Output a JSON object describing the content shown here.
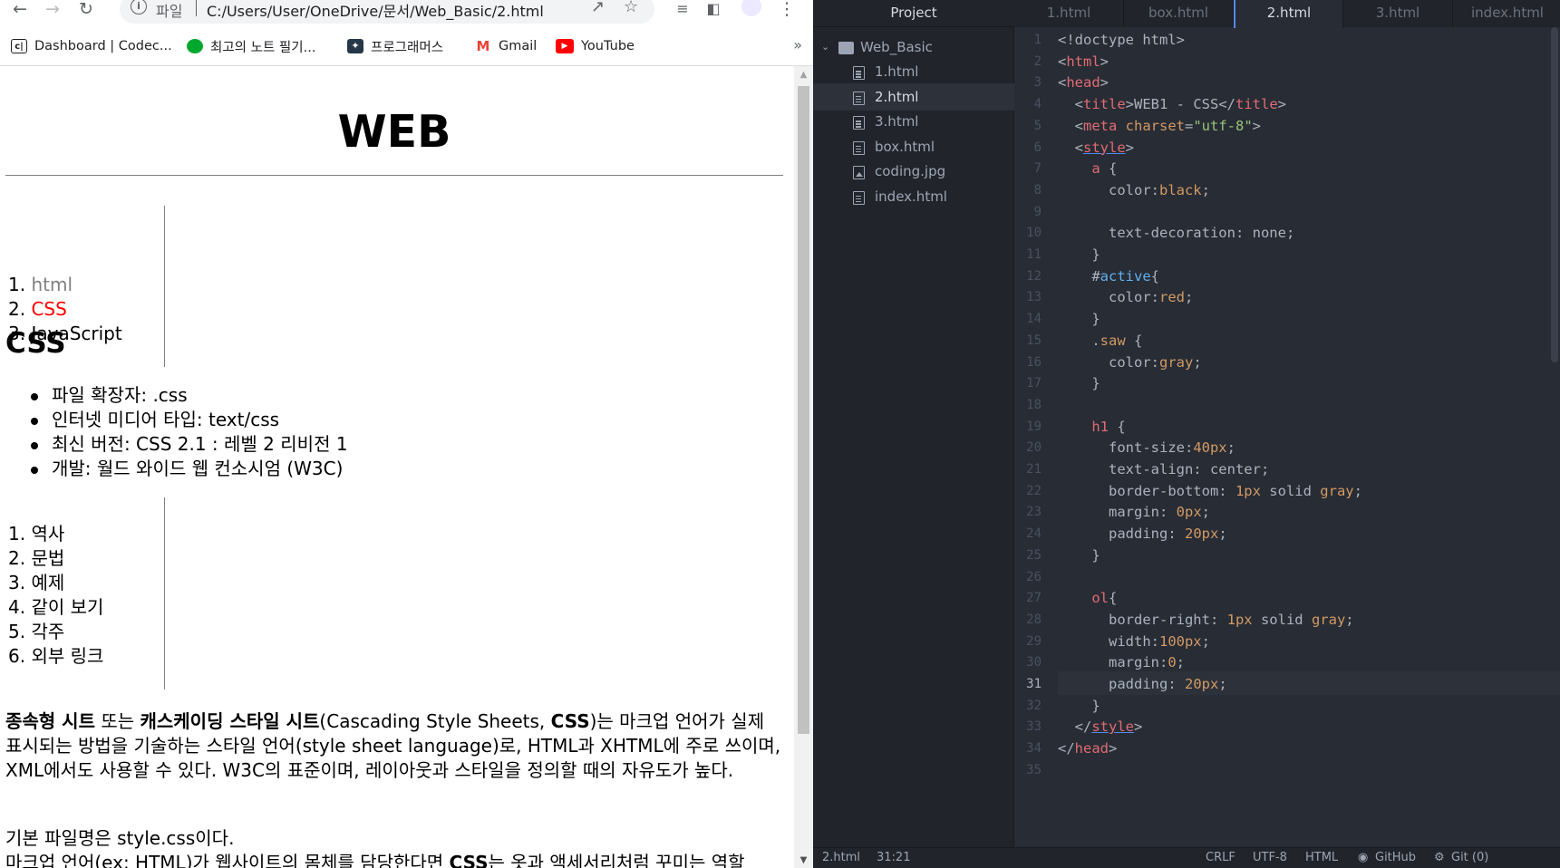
{
  "browser": {
    "url_scheme": "파일",
    "url": "C:/Users/User/OneDrive/문서/Web_Basic/2.html",
    "bookmarks": [
      {
        "label": "Dashboard | Codec...",
        "icon": "codecademy-icon",
        "color": "#1f1f1f"
      },
      {
        "label": "최고의 노트 필기...",
        "icon": "evernote-icon",
        "color": "#00a82d"
      },
      {
        "label": "프로그래머스",
        "icon": "programmers-icon",
        "color": "#263747"
      },
      {
        "label": "Gmail",
        "icon": "gmail-icon",
        "color": "#ea4335"
      },
      {
        "label": "YouTube",
        "icon": "youtube-icon",
        "color": "#ff0000"
      }
    ],
    "bookmarks_more": "»"
  },
  "page": {
    "h1": "WEB",
    "toc": [
      {
        "num": "1.",
        "label": "html",
        "style": "saw"
      },
      {
        "num": "2.",
        "label": "CSS",
        "style": "active"
      },
      {
        "num": "3.",
        "label": "JavaScript",
        "style": "normal"
      }
    ],
    "h2": "CSS",
    "facts": [
      "파일 확장자: .css",
      "인터넷 미디어 타입: text/css",
      "최신 버전: CSS 2.1 : 레벨 2 리비전 1",
      "개발: 월드 와이드 웹 컨소시엄 (W3C)"
    ],
    "sections": [
      "1. 역사",
      "2. 문법",
      "3. 예제",
      "4. 같이 보기",
      "5. 각주",
      "6. 외부 링크"
    ],
    "para1_b1": "종속형 시트",
    "para1_t1": " 또는 ",
    "para1_b2": "캐스케이딩 스타일 시트",
    "para1_t2": "(Cascading Style Sheets, ",
    "para1_b3": "CSS",
    "para1_t3": ")는 마크업 언어가 실제 표시되는 방법을 기술하는 스타일 언어(style sheet language)로, HTML과 XHTML에 주로 쓰이며, XML에서도 사용할 수 있다. W3C의 표준이며, 레이아웃과 스타일을 정의할 때의 자유도가 높다.",
    "para2_l1": "기본 파일명은 style.css이다.",
    "para2_t1": "마크업 언어(ex: HTML)가 웹사이트의 몸체를 담당한다면 ",
    "para2_b1": "CSS",
    "para2_t2": "는 옷과 액세서리처럼 꾸미는 역할"
  },
  "editor": {
    "project_title": "Project",
    "folder": "Web_Basic",
    "files": [
      {
        "name": "1.html",
        "icon": "file-icon"
      },
      {
        "name": "2.html",
        "icon": "file-icon",
        "selected": true
      },
      {
        "name": "3.html",
        "icon": "file-icon"
      },
      {
        "name": "box.html",
        "icon": "file-icon"
      },
      {
        "name": "coding.jpg",
        "icon": "image-icon"
      },
      {
        "name": "index.html",
        "icon": "file-icon"
      }
    ],
    "tabs": [
      "1.html",
      "box.html",
      "2.html",
      "3.html",
      "index.html"
    ],
    "active_tab": "2.html",
    "current_line": 31,
    "lines": [
      [
        [
          "c-plain",
          "<!doctype html>"
        ]
      ],
      [
        [
          "c-plain",
          "<"
        ],
        [
          "c-tag",
          "html"
        ],
        [
          "c-plain",
          ">"
        ]
      ],
      [
        [
          "c-plain",
          "<"
        ],
        [
          "c-tag",
          "head"
        ],
        [
          "c-plain",
          ">"
        ]
      ],
      [
        [
          "c-plain",
          "  <"
        ],
        [
          "c-tag",
          "title"
        ],
        [
          "c-plain",
          ">WEB1 - CSS</"
        ],
        [
          "c-tag",
          "title"
        ],
        [
          "c-plain",
          ">"
        ]
      ],
      [
        [
          "c-plain",
          "  <"
        ],
        [
          "c-tag",
          "meta"
        ],
        [
          "c-plain",
          " "
        ],
        [
          "c-attr",
          "charset"
        ],
        [
          "c-plain",
          "="
        ],
        [
          "c-str",
          "\"utf-8\""
        ],
        [
          "c-plain",
          ">"
        ]
      ],
      [
        [
          "c-plain",
          "  <"
        ],
        [
          "c-tag c-ul",
          "style"
        ],
        [
          "c-plain",
          ">"
        ]
      ],
      [
        [
          "c-plain",
          "    "
        ],
        [
          "c-sel",
          "a"
        ],
        [
          "c-plain",
          " {"
        ]
      ],
      [
        [
          "c-plain",
          "      color:"
        ],
        [
          "c-val",
          "black"
        ],
        [
          "c-plain",
          ";"
        ]
      ],
      [
        [
          "c-plain",
          ""
        ]
      ],
      [
        [
          "c-plain",
          "      text-decoration: none;"
        ]
      ],
      [
        [
          "c-plain",
          "    }"
        ]
      ],
      [
        [
          "c-plain",
          "    #"
        ],
        [
          "c-id",
          "active"
        ],
        [
          "c-plain",
          "{"
        ]
      ],
      [
        [
          "c-plain",
          "      color:"
        ],
        [
          "c-val",
          "red"
        ],
        [
          "c-plain",
          ";"
        ]
      ],
      [
        [
          "c-plain",
          "    }"
        ]
      ],
      [
        [
          "c-plain",
          "    ."
        ],
        [
          "c-val",
          "saw"
        ],
        [
          "c-plain",
          " {"
        ]
      ],
      [
        [
          "c-plain",
          "      color:"
        ],
        [
          "c-val",
          "gray"
        ],
        [
          "c-plain",
          ";"
        ]
      ],
      [
        [
          "c-plain",
          "    }"
        ]
      ],
      [
        [
          "c-plain",
          ""
        ]
      ],
      [
        [
          "c-plain",
          "    "
        ],
        [
          "c-sel",
          "h1"
        ],
        [
          "c-plain",
          " {"
        ]
      ],
      [
        [
          "c-plain",
          "      font-size:"
        ],
        [
          "c-val",
          "40px"
        ],
        [
          "c-plain",
          ";"
        ]
      ],
      [
        [
          "c-plain",
          "      text-align: center;"
        ]
      ],
      [
        [
          "c-plain",
          "      border-bottom: "
        ],
        [
          "c-val",
          "1px"
        ],
        [
          "c-plain",
          " solid "
        ],
        [
          "c-val",
          "gray"
        ],
        [
          "c-plain",
          ";"
        ]
      ],
      [
        [
          "c-plain",
          "      margin: "
        ],
        [
          "c-val",
          "0px"
        ],
        [
          "c-plain",
          ";"
        ]
      ],
      [
        [
          "c-plain",
          "      padding: "
        ],
        [
          "c-val",
          "20px"
        ],
        [
          "c-plain",
          ";"
        ]
      ],
      [
        [
          "c-plain",
          "    }"
        ]
      ],
      [
        [
          "c-plain",
          ""
        ]
      ],
      [
        [
          "c-plain",
          "    "
        ],
        [
          "c-sel",
          "ol"
        ],
        [
          "c-plain",
          "{"
        ]
      ],
      [
        [
          "c-plain",
          "      border-right: "
        ],
        [
          "c-val",
          "1px"
        ],
        [
          "c-plain",
          " solid "
        ],
        [
          "c-val",
          "gray"
        ],
        [
          "c-plain",
          ";"
        ]
      ],
      [
        [
          "c-plain",
          "      width:"
        ],
        [
          "c-val",
          "100px"
        ],
        [
          "c-plain",
          ";"
        ]
      ],
      [
        [
          "c-plain",
          "      margin:"
        ],
        [
          "c-val",
          "0"
        ],
        [
          "c-plain",
          ";"
        ]
      ],
      [
        [
          "c-plain",
          "      padding: "
        ],
        [
          "c-val",
          "20px"
        ],
        [
          "c-plain",
          ";"
        ]
      ],
      [
        [
          "c-plain",
          "    }"
        ]
      ],
      [
        [
          "c-plain",
          "  </"
        ],
        [
          "c-tag c-ul",
          "style"
        ],
        [
          "c-plain",
          ">"
        ]
      ],
      [
        [
          "c-plain",
          "</"
        ],
        [
          "c-tag",
          "head"
        ],
        [
          "c-plain",
          ">"
        ]
      ],
      [
        [
          "c-plain",
          ""
        ]
      ]
    ],
    "status": {
      "file": "2.html",
      "cursor": "31:21",
      "eol": "CRLF",
      "encoding": "UTF-8",
      "grammar": "HTML",
      "github": "GitHub",
      "git": "Git (0)"
    }
  }
}
